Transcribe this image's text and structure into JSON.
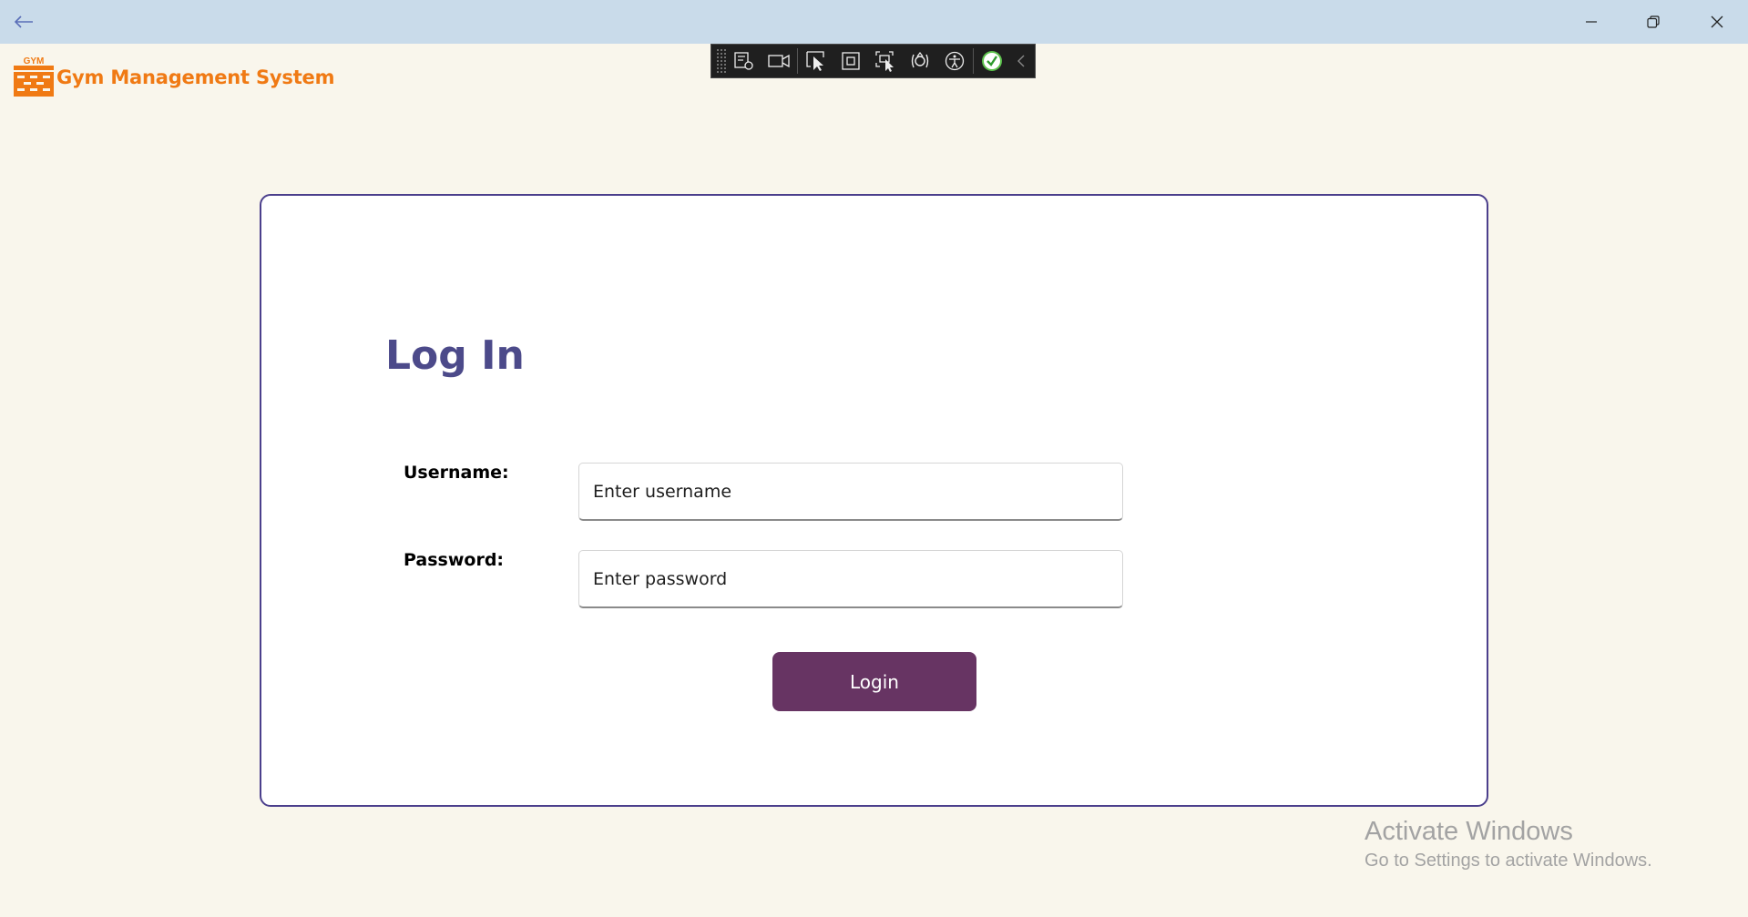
{
  "app": {
    "title": "Gym Management System",
    "logo_text": "GYM",
    "accent_color": "#f07a14"
  },
  "window": {
    "back_icon": "back-arrow-icon",
    "minimize_icon": "minimize-icon",
    "restore_icon": "restore-icon",
    "close_icon": "close-icon"
  },
  "debug_toolbar": {
    "tools": [
      "live-visual-tree-icon",
      "record-icon",
      "select-element-icon",
      "display-layout-adorners-icon",
      "track-focus-icon",
      "hot-reload-icon",
      "accessibility-icon",
      "binding-check-icon",
      "collapse-chevron-icon"
    ]
  },
  "login": {
    "heading": "Log In",
    "heading_color": "#4c4a8a",
    "username_label": "Username:",
    "username_placeholder": "Enter username",
    "username_value": "",
    "password_label": "Password:",
    "password_placeholder": "Enter password",
    "password_value": "",
    "button_label": "Login",
    "button_color": "#673463",
    "card_border_color": "#4b3f8c"
  },
  "watermark": {
    "title": "Activate Windows",
    "subtitle": "Go to Settings to activate Windows."
  }
}
